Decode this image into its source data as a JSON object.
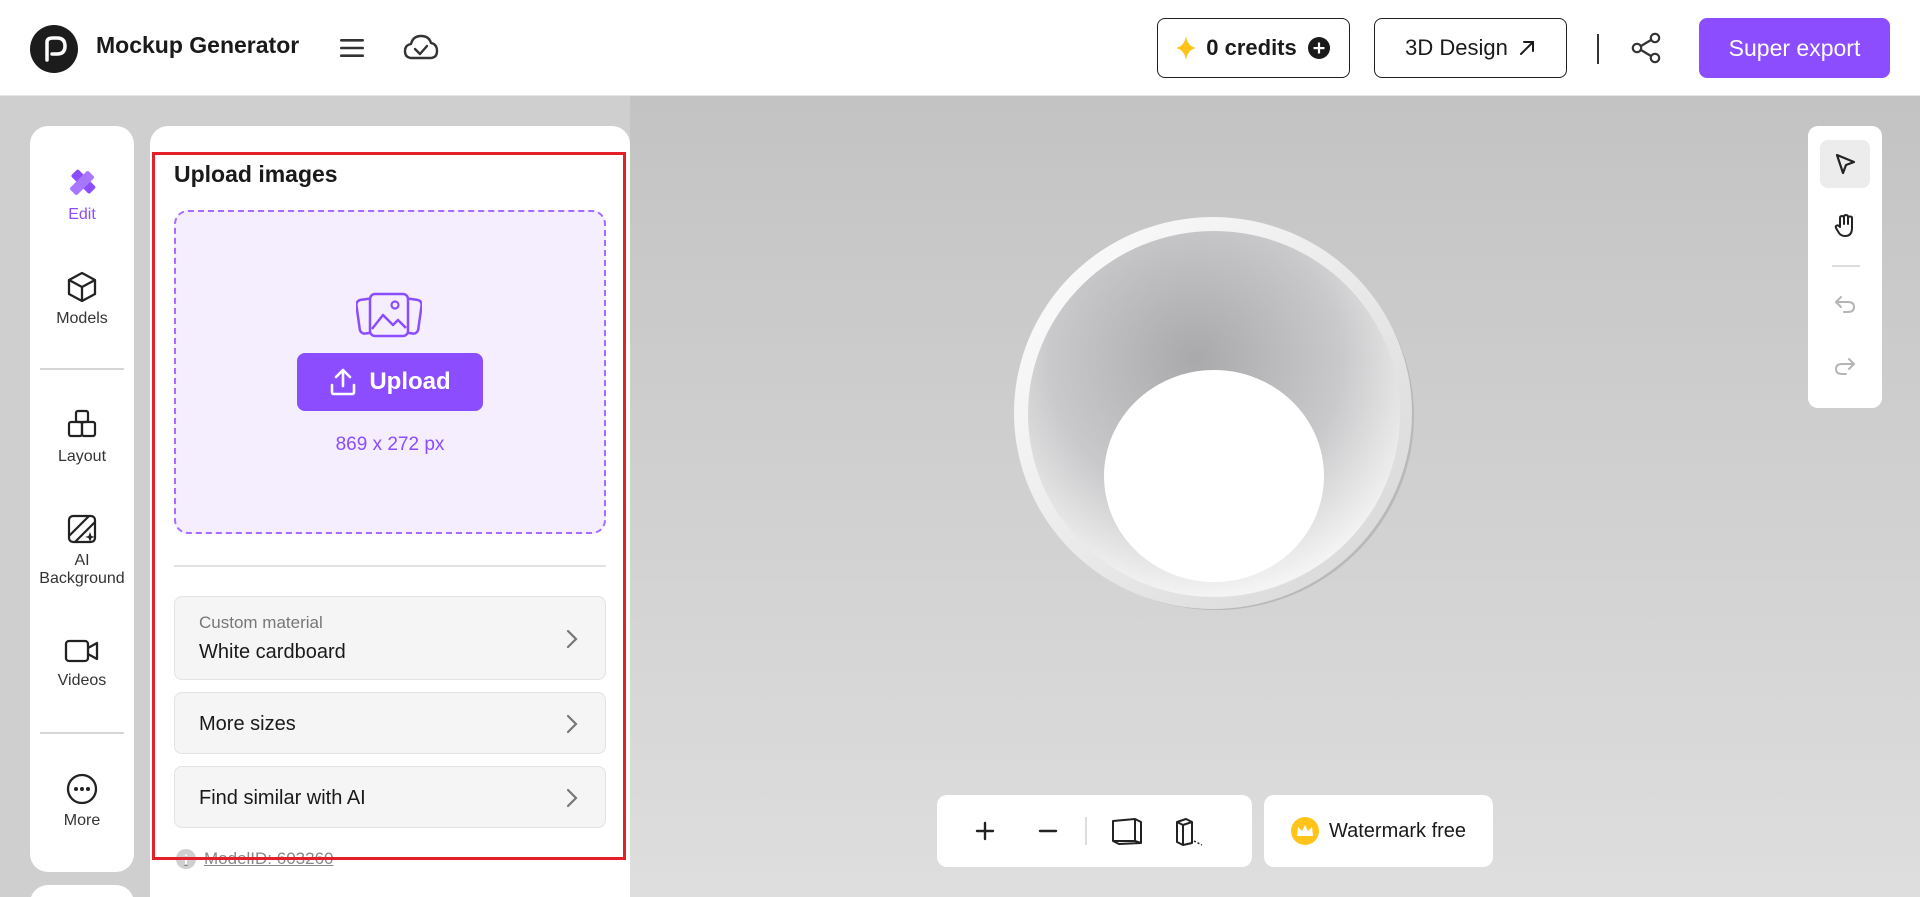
{
  "header": {
    "app_title": "Mockup Generator",
    "credits_label": "0 credits",
    "design_label": "3D Design",
    "export_label": "Super export"
  },
  "rail": {
    "items": [
      {
        "label": "Edit",
        "icon": "edit-pencil-ruler-icon"
      },
      {
        "label": "Models",
        "icon": "cube-icon"
      },
      {
        "label": "Layout",
        "icon": "boxes-icon"
      },
      {
        "label": "AI Background",
        "icon": "ai-background-icon"
      },
      {
        "label": "Videos",
        "icon": "video-camera-icon"
      },
      {
        "label": "More",
        "icon": "more-dots-icon"
      }
    ]
  },
  "panel": {
    "title": "Upload images",
    "upload_label": "Upload",
    "dimensions": "869 x 272 px",
    "material_caption": "Custom material",
    "material_value": "White cardboard",
    "more_sizes": "More sizes",
    "find_similar": "Find similar with AI",
    "model_id": "ModelID: 603260"
  },
  "canvas": {
    "watermark_label": "Watermark free"
  },
  "colors": {
    "accent": "#8b4dff",
    "highlight": "#e3202a",
    "credit_star": "#ffc31a"
  }
}
